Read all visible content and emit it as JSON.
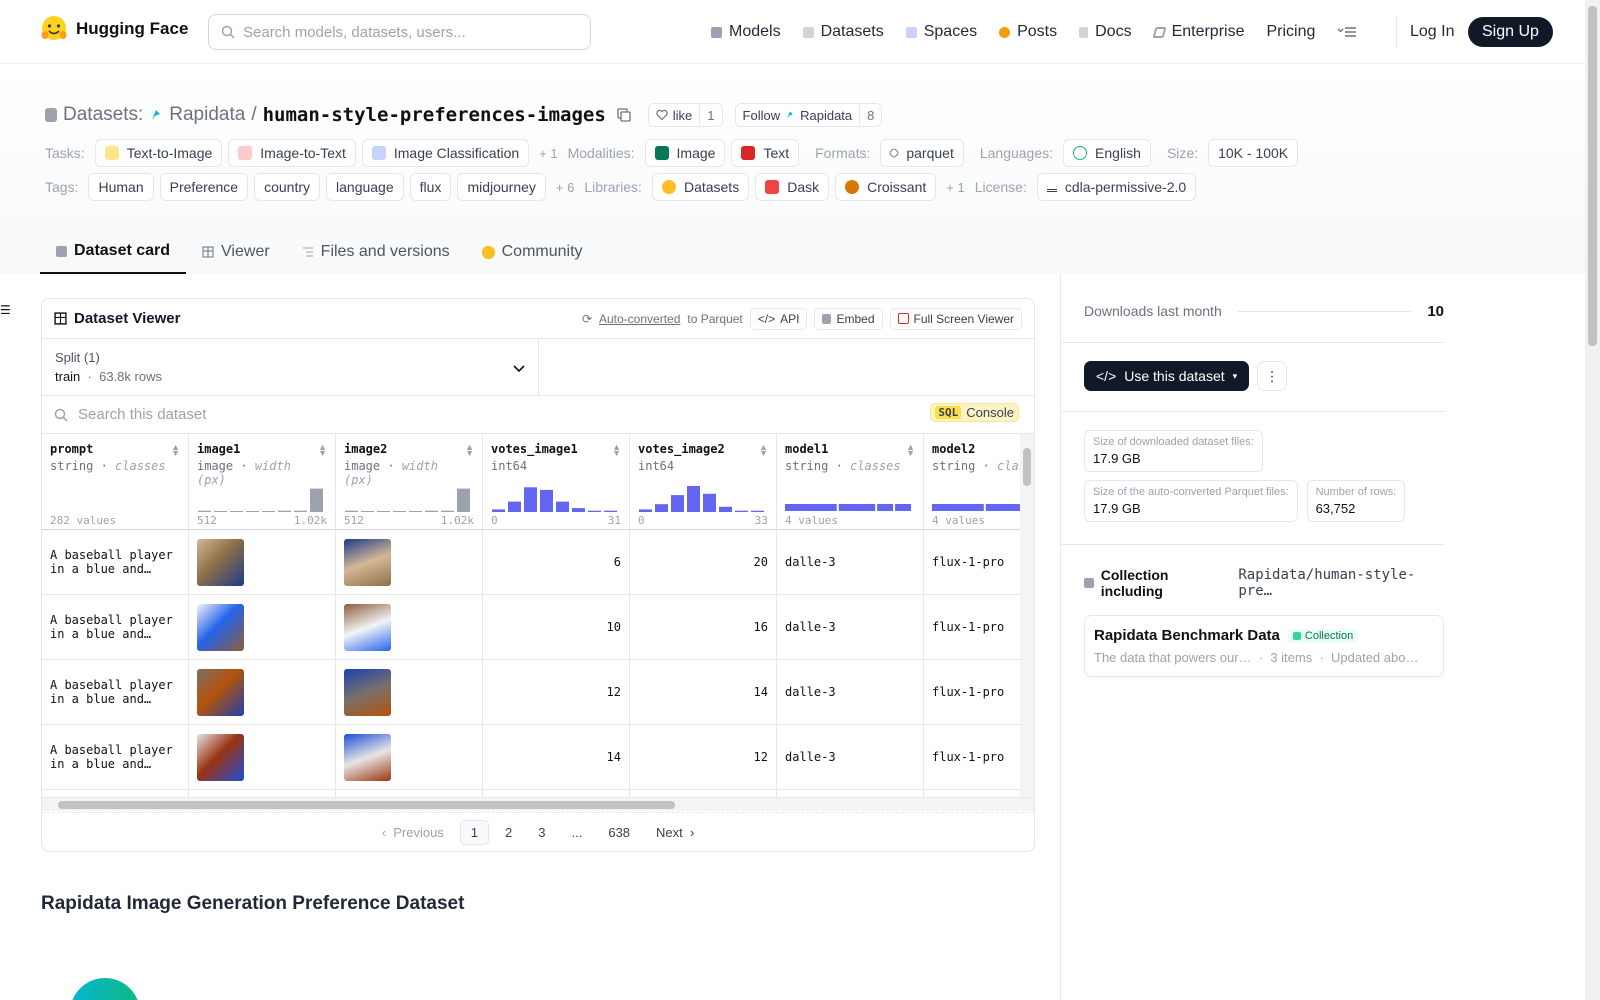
{
  "nav": {
    "brand": "Hugging Face",
    "search_placeholder": "Search models, datasets, users...",
    "links": [
      "Models",
      "Datasets",
      "Spaces",
      "Posts",
      "Docs",
      "Enterprise",
      "Pricing"
    ],
    "login": "Log In",
    "signup": "Sign Up"
  },
  "header": {
    "section": "Datasets:",
    "owner": "Rapidata",
    "sep": "/",
    "name": "human-style-preferences-images",
    "like_label": "like",
    "like_count": "1",
    "follow_label": "Follow",
    "follow_org": "Rapidata",
    "follow_count": "8",
    "tasks_label": "Tasks:",
    "tasks": [
      "Text-to-Image",
      "Image-to-Text",
      "Image Classification"
    ],
    "tasks_more": "+ 1",
    "modalities_label": "Modalities:",
    "modalities": [
      "Image",
      "Text"
    ],
    "formats_label": "Formats:",
    "format": "parquet",
    "languages_label": "Languages:",
    "language": "English",
    "size_label": "Size:",
    "size": "10K - 100K",
    "tags_label": "Tags:",
    "tags": [
      "Human",
      "Preference",
      "country",
      "language",
      "flux",
      "midjourney"
    ],
    "tags_more": "+ 6",
    "libraries_label": "Libraries:",
    "libraries": [
      "Datasets",
      "Dask",
      "Croissant"
    ],
    "libraries_more": "+ 1",
    "license_label": "License:",
    "license": "cdla-permissive-2.0",
    "tabs": [
      "Dataset card",
      "Viewer",
      "Files and versions",
      "Community"
    ]
  },
  "viewer": {
    "title": "Dataset Viewer",
    "auto_converted": "Auto-converted",
    "to_parquet": "to Parquet",
    "api": "API",
    "embed": "Embed",
    "fullscreen": "Full Screen Viewer",
    "split_label": "Split (1)",
    "split_name": "train",
    "split_rows": "63.8k rows",
    "search_placeholder": "Search this dataset",
    "sql": "SQL",
    "console": "Console",
    "columns": [
      {
        "name": "prompt",
        "type": "string",
        "sub": "classes",
        "foot_left": "282 values",
        "foot_right": ""
      },
      {
        "name": "image1",
        "type": "image",
        "sub": "width (px)",
        "foot_left": "512",
        "foot_right": "1.02k"
      },
      {
        "name": "image2",
        "type": "image",
        "sub": "width (px)",
        "foot_left": "512",
        "foot_right": "1.02k"
      },
      {
        "name": "votes_image1",
        "type": "int64",
        "sub": "",
        "foot_left": "0",
        "foot_right": "31"
      },
      {
        "name": "votes_image2",
        "type": "int64",
        "sub": "",
        "foot_left": "0",
        "foot_right": "33"
      },
      {
        "name": "model1",
        "type": "string",
        "sub": "classes",
        "foot_left": "4 values",
        "foot_right": ""
      },
      {
        "name": "model2",
        "type": "string",
        "sub": "classes",
        "foot_left": "4 values",
        "foot_right": ""
      }
    ],
    "rows": [
      {
        "prompt_l1": "A baseball player",
        "prompt_l2": "in a blue and…",
        "votes1": "6",
        "votes2": "20",
        "model1": "dalle-3",
        "model2": "flux-1-pro"
      },
      {
        "prompt_l1": "A baseball player",
        "prompt_l2": "in a blue and…",
        "votes1": "10",
        "votes2": "16",
        "model1": "dalle-3",
        "model2": "flux-1-pro"
      },
      {
        "prompt_l1": "A baseball player",
        "prompt_l2": "in a blue and…",
        "votes1": "12",
        "votes2": "14",
        "model1": "dalle-3",
        "model2": "flux-1-pro"
      },
      {
        "prompt_l1": "A baseball player",
        "prompt_l2": "in a blue and…",
        "votes1": "14",
        "votes2": "12",
        "model1": "dalle-3",
        "model2": "flux-1-pro"
      }
    ],
    "pager": {
      "prev": "Previous",
      "pages": [
        "1",
        "2",
        "3",
        "...",
        "638"
      ],
      "next": "Next"
    }
  },
  "card_heading": "Rapidata Image Generation Preference Dataset",
  "sidebar": {
    "downloads_label": "Downloads last month",
    "downloads_value": "10",
    "use_button": "Use this dataset",
    "stats": [
      {
        "label": "Size of downloaded dataset files:",
        "value": "17.9 GB"
      },
      {
        "label": "Size of the auto-converted Parquet files:",
        "value": "17.9 GB"
      },
      {
        "label": "Number of rows:",
        "value": "63,752"
      }
    ],
    "collection_prefix": "Collection including",
    "collection_repo": "Rapidata/human-style-pre…",
    "collection_title": "Rapidata Benchmark Data",
    "collection_badge": "Collection",
    "collection_desc": "The data that powers our…",
    "collection_items": "3 items",
    "collection_updated": "Updated abo…"
  },
  "colors": {
    "accent": "#6366f1",
    "dark": "#111827",
    "muted": "#6b7280",
    "border": "#e5e7eb"
  }
}
